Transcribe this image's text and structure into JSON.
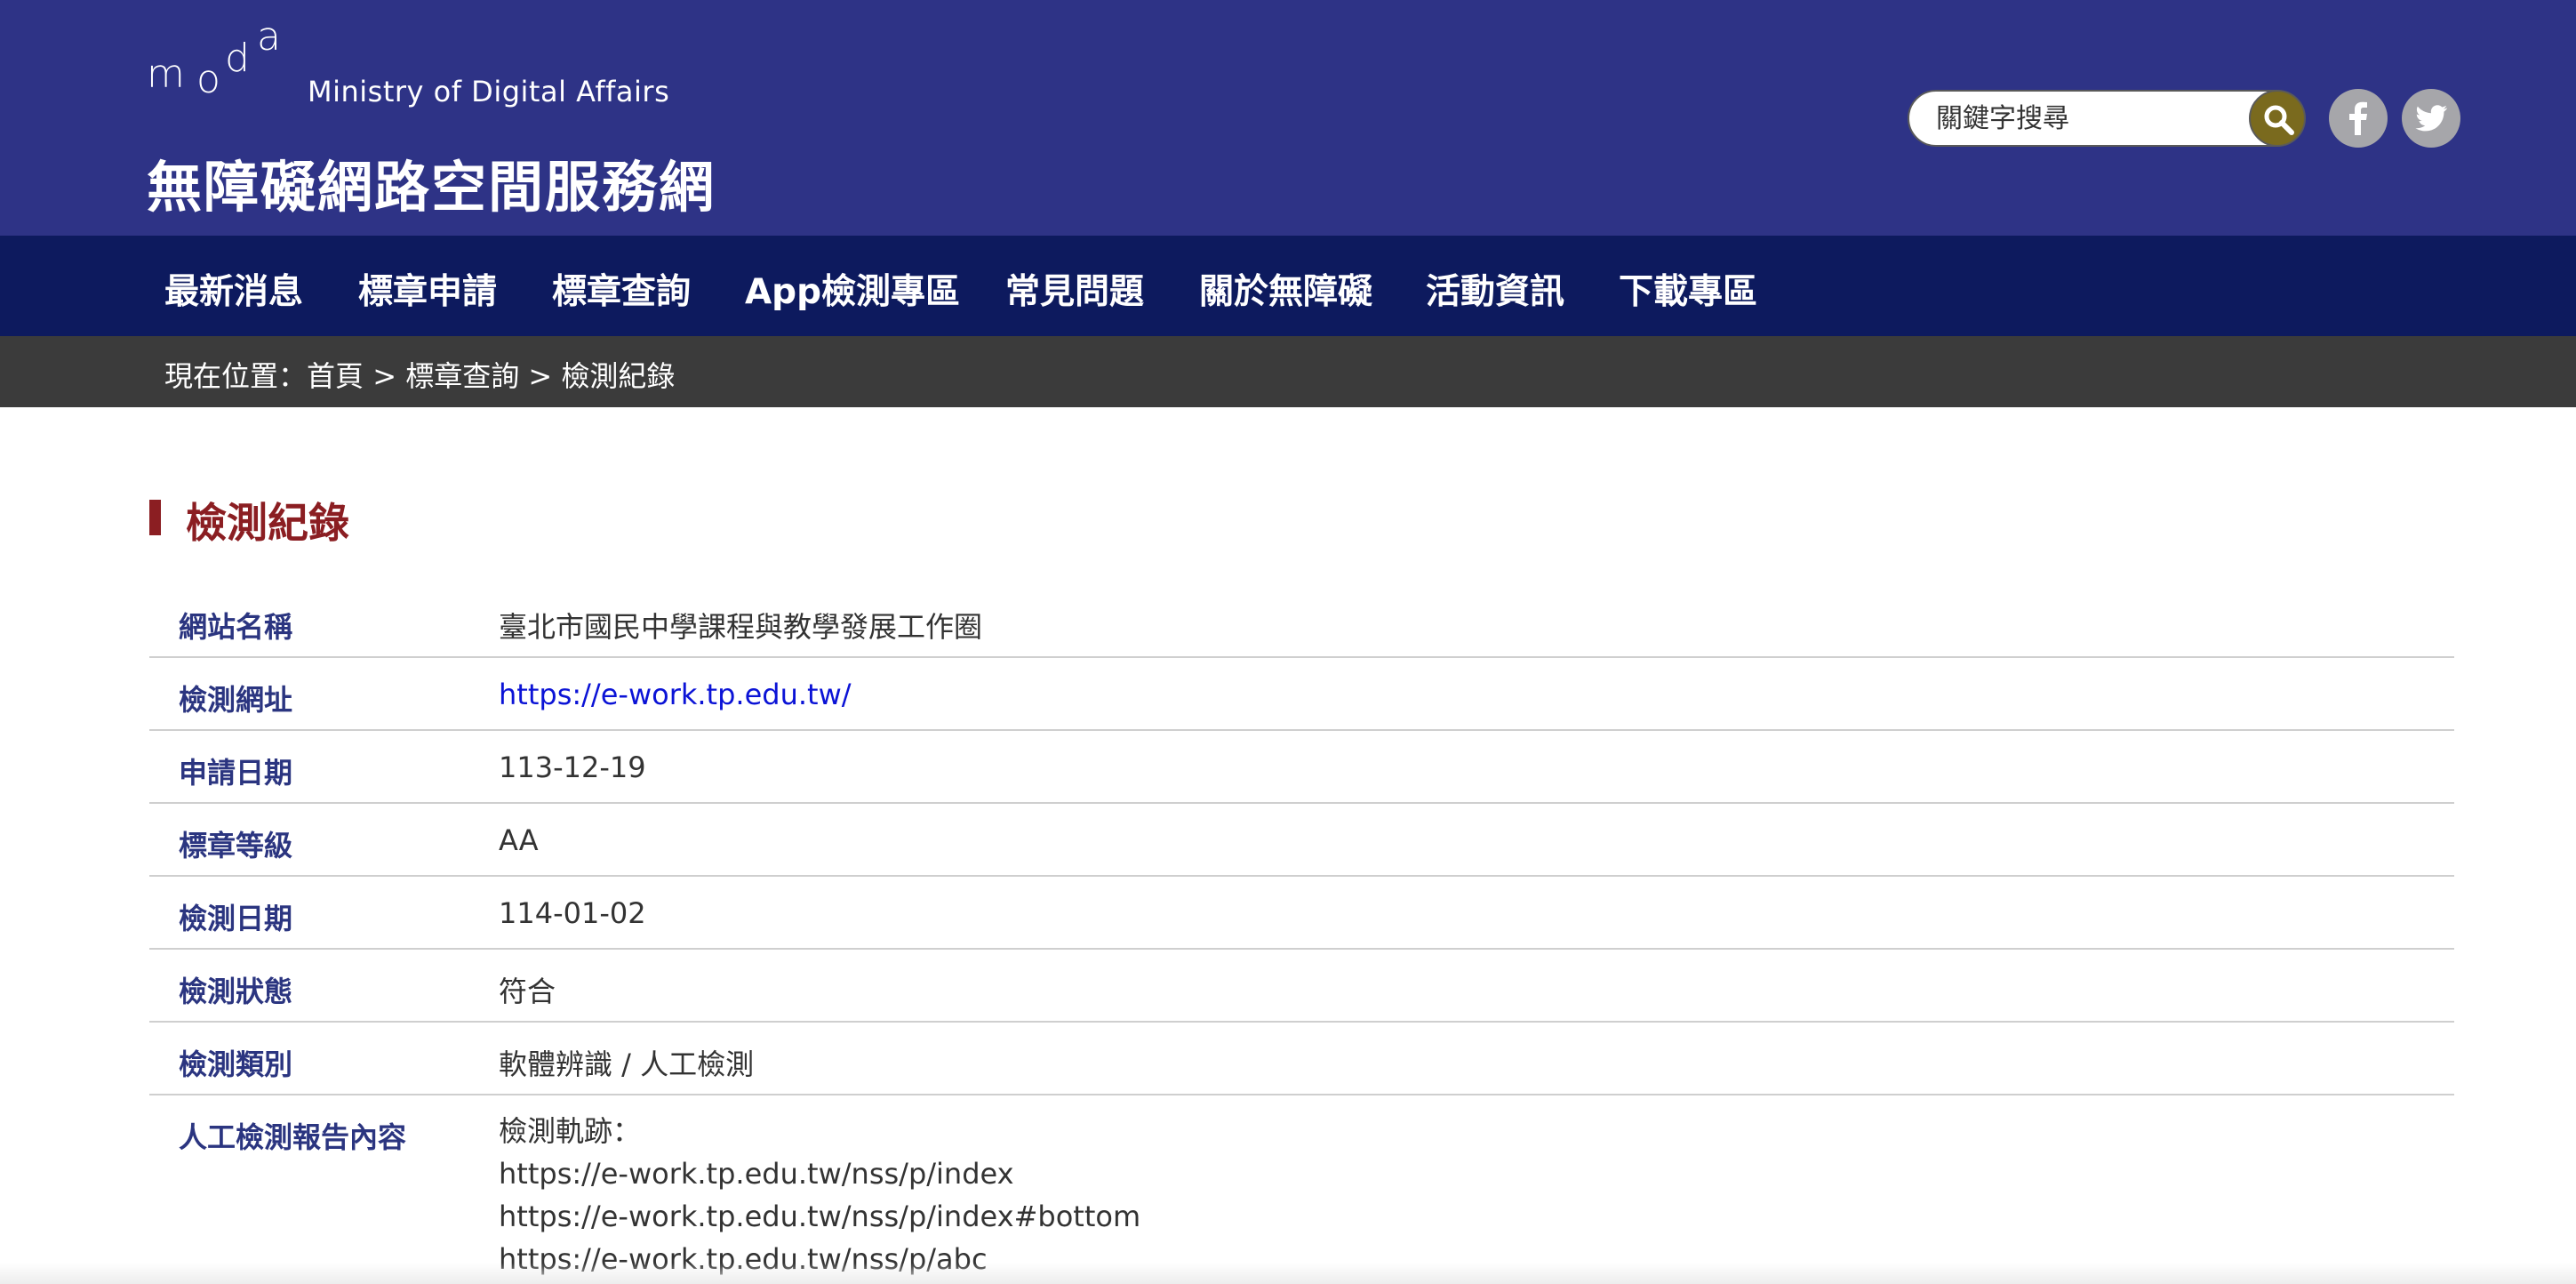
{
  "header": {
    "logo_letters": [
      "m",
      "o",
      "d",
      "a"
    ],
    "ministry": "Ministry of Digital Affairs",
    "site_title": "無障礙網路空間服務網",
    "search_placeholder": "關鍵字搜尋"
  },
  "nav": {
    "items": [
      "最新消息",
      "標章申請",
      "標章查詢",
      "App檢測專區",
      "常見問題",
      "關於無障礙",
      "活動資訊",
      "下載專區"
    ]
  },
  "breadcrumb": {
    "prefix": "現在位置：",
    "home": "首頁",
    "sep1": " > ",
    "level1": "標章查詢",
    "sep2": " > ",
    "current": "檢測紀錄"
  },
  "page": {
    "heading": "檢測紀錄"
  },
  "record": {
    "rows": [
      {
        "label": "網站名稱",
        "value": "臺北市國民中學課程與教學發展工作圈"
      },
      {
        "label": "檢測網址",
        "value": "https://e-work.tp.edu.tw/"
      },
      {
        "label": "申請日期",
        "value": "113-12-19"
      },
      {
        "label": "標章等級",
        "value": "AA"
      },
      {
        "label": "檢測日期",
        "value": "114-01-02"
      },
      {
        "label": "檢測狀態",
        "value": "符合"
      },
      {
        "label": "檢測類別",
        "value": "軟體辨識 / 人工檢測"
      }
    ],
    "report": {
      "label": "人工檢測報告內容",
      "lines": [
        "檢測軌跡：",
        "https://e-work.tp.edu.tw/nss/p/index",
        "https://e-work.tp.edu.tw/nss/p/index#bottom",
        "https://e-work.tp.edu.tw/nss/p/abc"
      ]
    }
  },
  "colors": {
    "header_bg": "#2e3386",
    "nav_bg": "#0d1a5e",
    "breadcrumb_bg": "#3b3b3b",
    "heading": "#8b1e22",
    "label": "#2b3580",
    "link": "#0b13d6"
  }
}
